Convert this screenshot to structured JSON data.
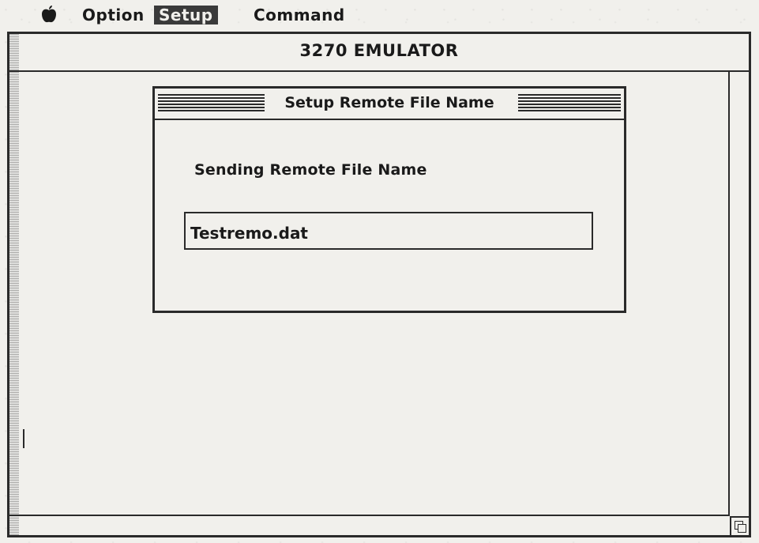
{
  "menubar": {
    "apple_icon": "apple-icon",
    "items": [
      {
        "label": "Option",
        "selected": false
      },
      {
        "label": "Setup",
        "selected": true
      },
      {
        "label": "Command",
        "selected": false
      }
    ]
  },
  "window": {
    "title": "3270 EMULATOR"
  },
  "dialog": {
    "title": "Setup Remote File Name",
    "prompt": "Sending Remote File Name",
    "file_name_value": "Testremo.dat"
  },
  "colors": {
    "foreground": "#2a2a2a",
    "background": "#f1f0ec",
    "menu_highlight": "#3a3a3a"
  }
}
